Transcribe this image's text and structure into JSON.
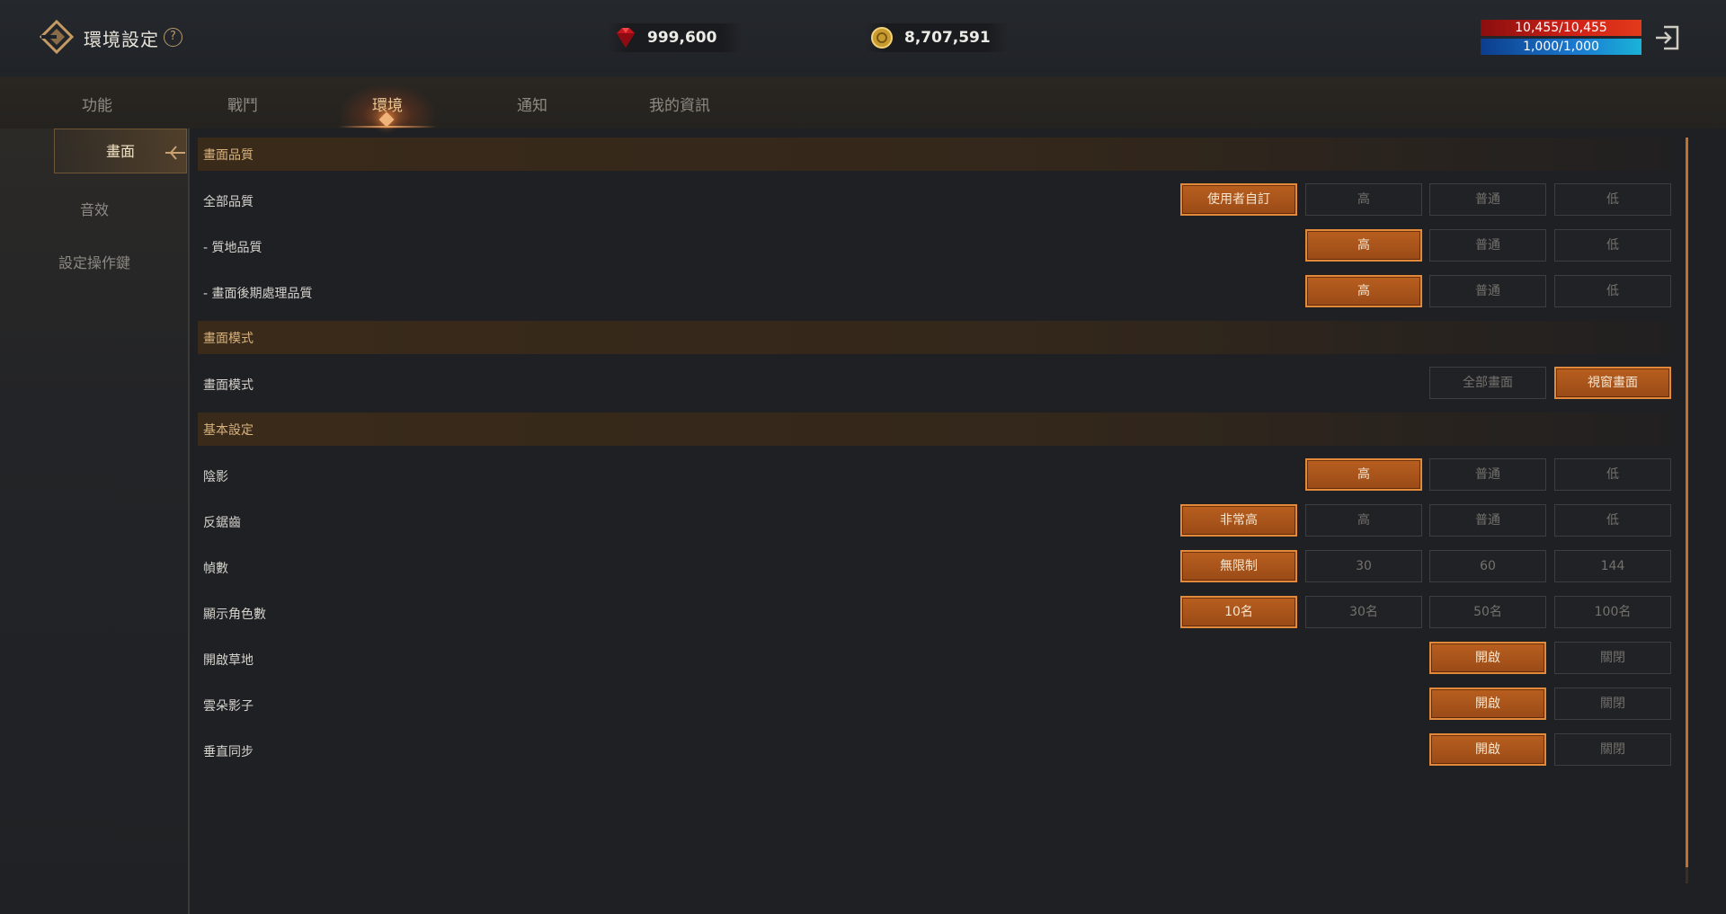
{
  "header": {
    "title": "環境設定",
    "help": "?",
    "gems": "999,600",
    "gold": "8,707,591",
    "hp": "10,455/10,455",
    "mp": "1,000/1,000",
    "logo_icon": "game-logo-icon",
    "gem_icon": "red-gem-icon",
    "gold_icon": "gold-coin-icon",
    "exit_icon": "exit-icon"
  },
  "tabs": [
    {
      "label": "功能"
    },
    {
      "label": "戰鬥"
    },
    {
      "label": "環境"
    },
    {
      "label": "通知"
    },
    {
      "label": "我的資訊"
    }
  ],
  "sidebar": {
    "items": [
      {
        "label": "畫面"
      },
      {
        "label": "音效"
      },
      {
        "label": "設定操作鍵"
      }
    ]
  },
  "sections": {
    "quality": "畫面品質",
    "mode": "畫面模式",
    "basic": "基本設定"
  },
  "rows": {
    "all_quality": {
      "label": "全部品質",
      "options": [
        "使用者自訂",
        "高",
        "普通",
        "低"
      ],
      "selected": "使用者自訂"
    },
    "texture": {
      "label": "- 質地品質",
      "options": [
        "高",
        "普通",
        "低"
      ],
      "selected": "高"
    },
    "postprocess": {
      "label": "- 畫面後期處理品質",
      "options": [
        "高",
        "普通",
        "低"
      ],
      "selected": "高"
    },
    "display_mode": {
      "label": "畫面模式",
      "options": [
        "全部畫面",
        "視窗畫面"
      ],
      "selected": "視窗畫面"
    },
    "shadow": {
      "label": "陰影",
      "options": [
        "高",
        "普通",
        "低"
      ],
      "selected": "高"
    },
    "antialias": {
      "label": "反鋸齒",
      "options": [
        "非常高",
        "高",
        "普通",
        "低"
      ],
      "selected": "非常高"
    },
    "fps": {
      "label": "幀數",
      "options": [
        "無限制",
        "30",
        "60",
        "144"
      ],
      "selected": "無限制"
    },
    "characters": {
      "label": "顯示角色數",
      "options": [
        "10名",
        "30名",
        "50名",
        "100名"
      ],
      "selected": "10名"
    },
    "grass": {
      "label": "開啟草地",
      "options": [
        "開啟",
        "關閉"
      ],
      "selected": "開啟"
    },
    "cloud_shadow": {
      "label": "雲朵影子",
      "options": [
        "開啟",
        "關閉"
      ],
      "selected": "開啟"
    },
    "vsync": {
      "label": "垂直同步",
      "options": [
        "開啟",
        "關閉"
      ],
      "selected": "開啟"
    }
  },
  "colors": {
    "accent": "#c3702d",
    "section_text": "#d8b37e",
    "hp": "#d12318",
    "mp": "#1b7ad0"
  }
}
